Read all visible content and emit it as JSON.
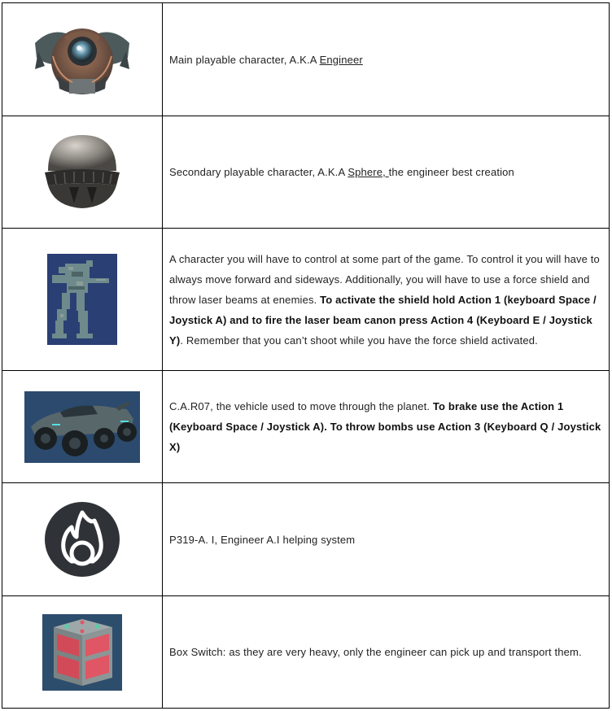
{
  "rows": [
    {
      "image": "engineer-character-icon",
      "text": "Main playable character, A.K.A ",
      "link": "Engineer"
    },
    {
      "image": "sphere-character-icon",
      "text": "Secondary playable character, A.K.A ",
      "link": "Sphere, ",
      "text_after": "the engineer best creation"
    },
    {
      "image": "mech-robot-icon",
      "text": "A character you will have to control at some part of the game. To control it you will have to always move forward and sideways. Additionally, you will have to use a force shield and throw laser beams at enemies. ",
      "bold": "To activate the shield hold Action 1 (keyboard Space / Joystick A) and to fire the laser beam canon press Action 4 (Keyboard E / Joystick Y)",
      "text_after": ". Remember that you can’t shoot while you have the force shield activated."
    },
    {
      "image": "car-vehicle-icon",
      "text": "C.A.R07, the vehicle used to move through the planet. ",
      "bold": "To brake use the Action 1 (Keyboard Space / Joystick A). To throw bombs use Action 3 (Keyboard Q / Joystick X)"
    },
    {
      "image": "flame-ai-logo-icon",
      "text": "P319-A. I, Engineer A.I helping system"
    },
    {
      "image": "box-switch-icon",
      "text": "Box Switch: as they are very heavy, only the engineer can pick up and transport them."
    }
  ]
}
